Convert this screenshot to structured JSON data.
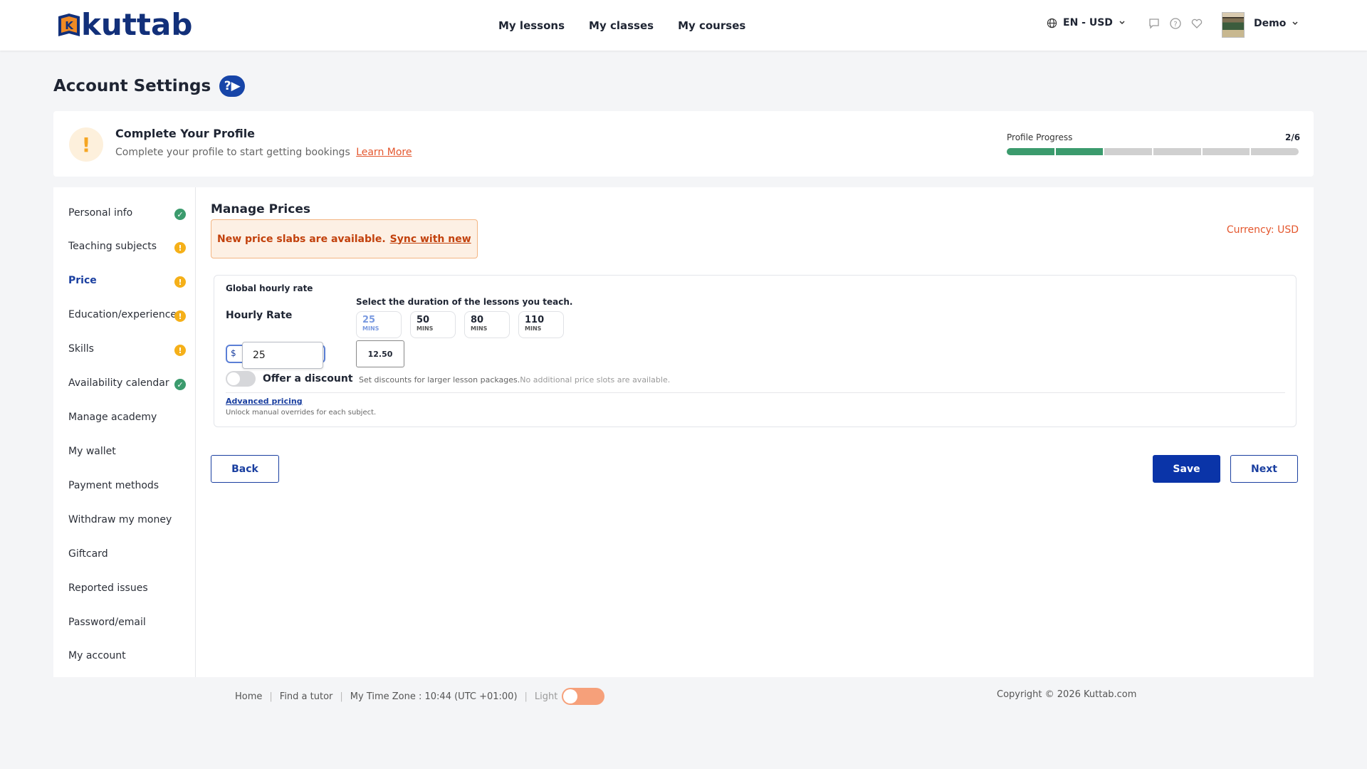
{
  "header": {
    "logo_text": "kuttab",
    "nav": [
      "My lessons",
      "My classes",
      "My courses"
    ],
    "language": "EN - USD",
    "user_name": "Demo"
  },
  "page": {
    "title": "Account Settings"
  },
  "profile": {
    "title": "Complete Your Profile",
    "subtitle": "Complete your profile to start getting bookings",
    "learn_more": "Learn More",
    "progress_label": "Profile Progress",
    "progress_count": "2/6",
    "progress_done": 2,
    "progress_total": 6
  },
  "sidebar": {
    "items": [
      {
        "label": "Personal info",
        "status": "ok"
      },
      {
        "label": "Teaching subjects",
        "status": "warn"
      },
      {
        "label": "Price",
        "status": "warn",
        "active": true
      },
      {
        "label": "Education/experience",
        "status": "warn"
      },
      {
        "label": "Skills",
        "status": "warn"
      },
      {
        "label": "Availability calendar",
        "status": "ok"
      },
      {
        "label": "Manage academy",
        "status": ""
      },
      {
        "label": "My wallet",
        "status": ""
      },
      {
        "label": "Payment methods",
        "status": ""
      },
      {
        "label": "Withdraw my money",
        "status": ""
      },
      {
        "label": "Giftcard",
        "status": ""
      },
      {
        "label": "Reported issues",
        "status": ""
      },
      {
        "label": "Password/email",
        "status": ""
      },
      {
        "label": "My account",
        "status": ""
      }
    ]
  },
  "prices": {
    "title": "Manage Prices",
    "alert_text": "New price slabs are available.",
    "alert_link": "Sync with new",
    "currency": "Currency: USD",
    "global_label": "Global hourly rate",
    "hourly_label": "Hourly Rate",
    "duration_label": "Select the duration of the lessons you teach.",
    "durations": [
      {
        "value": "25",
        "unit": "MINS",
        "selected": true
      },
      {
        "value": "50",
        "unit": "MINS"
      },
      {
        "value": "80",
        "unit": "MINS"
      },
      {
        "value": "110",
        "unit": "MINS"
      }
    ],
    "currency_symbol": "$",
    "rate_value": "25",
    "price_25": "12.50",
    "discount_label": "Offer a discount",
    "discount_help": "Set discounts for larger lesson packages.",
    "discount_help_muted": "No additional price slots are available.",
    "advanced_link": "Advanced pricing",
    "advanced_sub": "Unlock manual overrides for each subject.",
    "back": "Back",
    "save": "Save",
    "next": "Next"
  },
  "footer": {
    "home": "Home",
    "find_tutor": "Find a tutor",
    "timezone": "My Time Zone : 10:44 (UTC +01:00)",
    "theme": "Light",
    "copyright": "Copyright © 2026 Kuttab.com"
  },
  "colors": {
    "brand": "#12307a",
    "accent": "#e4572e",
    "primary_button": "#0a34a8",
    "success": "#3b9b6d",
    "warning": "#f5b019"
  }
}
